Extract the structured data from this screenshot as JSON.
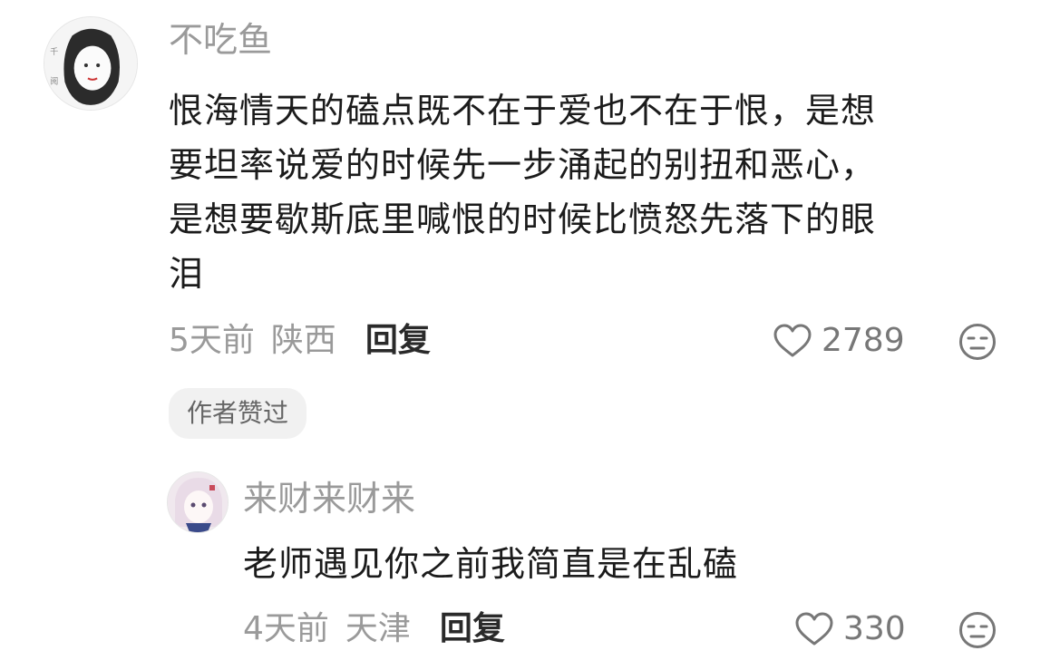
{
  "comments": [
    {
      "username": "不吃鱼",
      "lines": [
        "恨海情天的磕点既不在于爱也不在于恨，是想",
        "要坦率说爱的时候先一步涌起的别扭和恶心，",
        "是想要歇斯底里喊恨的时候比愤怒先落下的眼",
        "泪"
      ],
      "time": "5天前",
      "location": "陕西",
      "reply_label": "回复",
      "likes": "2789",
      "badge": "作者赞过"
    },
    {
      "username": "来财来财来",
      "text": "老师遇见你之前我简直是在乱磕",
      "time": "4天前",
      "location": "天津",
      "reply_label": "回复",
      "likes": "330"
    }
  ],
  "icons": {
    "like": "heart-outline-icon",
    "dislike": "meh-face-icon"
  },
  "colors": {
    "username": "#9a9a9a",
    "text": "#1b1b1b",
    "badge_bg": "#f1f1f1"
  }
}
